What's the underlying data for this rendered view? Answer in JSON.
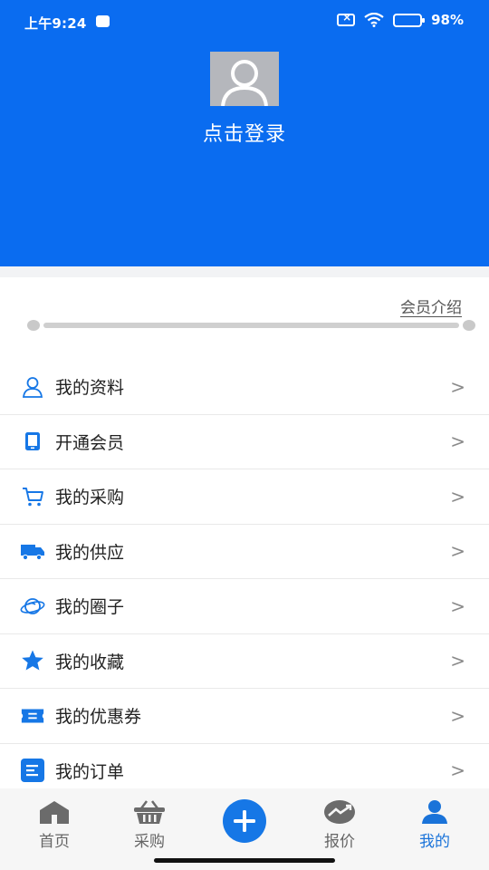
{
  "status_bar": {
    "time": "上午9:24",
    "battery": "98%"
  },
  "profile": {
    "login_label": "点击登录"
  },
  "membership": {
    "intro_link": "会员介绍",
    "progress": 0.0
  },
  "menu": [
    {
      "label": "我的资料",
      "icon": "user-outline-icon"
    },
    {
      "label": "开通会员",
      "icon": "tablet-icon"
    },
    {
      "label": "我的采购",
      "icon": "cart-icon"
    },
    {
      "label": "我的供应",
      "icon": "truck-icon"
    },
    {
      "label": "我的圈子",
      "icon": "planet-icon"
    },
    {
      "label": "我的收藏",
      "icon": "star-icon"
    },
    {
      "label": "我的优惠券",
      "icon": "coupon-icon"
    },
    {
      "label": "我的订单",
      "icon": "order-list-icon"
    }
  ],
  "arrow": ">",
  "tabbar": {
    "tabs": [
      {
        "label": "首页",
        "icon": "home-icon"
      },
      {
        "label": "采购",
        "icon": "basket-icon"
      },
      {
        "label": "",
        "icon": "plus-icon"
      },
      {
        "label": "报价",
        "icon": "trend-icon"
      },
      {
        "label": "我的",
        "icon": "user-icon"
      }
    ],
    "active_index": 4
  },
  "colors": {
    "brand_blue": "#0a6cf0",
    "icon_blue": "#1677e6",
    "active_tab": "#1a73d9"
  }
}
